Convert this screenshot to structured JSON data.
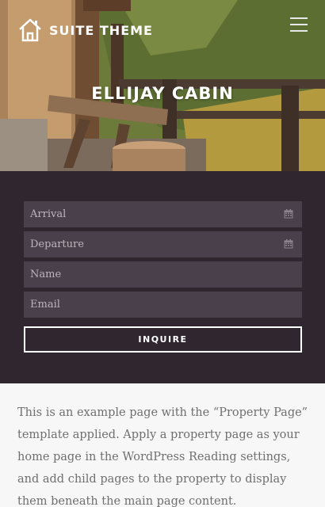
{
  "header": {
    "site_title": "SUITE THEME",
    "logo_icon": "house-icon",
    "menu_icon": "hamburger-menu-icon"
  },
  "hero": {
    "title": "ELLIJAY CABIN"
  },
  "form": {
    "arrival_placeholder": "Arrival",
    "departure_placeholder": "Departure",
    "name_placeholder": "Name",
    "email_placeholder": "Email",
    "calendar_icon": "calendar-icon",
    "submit_label": "INQUIRE"
  },
  "content": {
    "paragraph": "This is an example page with the “Property Page” template applied. Apply a property page as your home page in the WordPress Reading settings, and add child pages to the property to display them beneath the main page content."
  },
  "colors": {
    "form_background": "#2f2630",
    "field_background": "#4a404b",
    "body_text": "#6f6f6f",
    "page_background": "#f7f7f7"
  }
}
